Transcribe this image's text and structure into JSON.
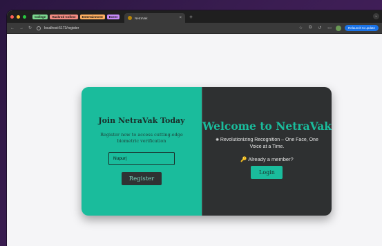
{
  "browser": {
    "tab_groups": [
      {
        "label": "College",
        "color": "#7bd88f"
      },
      {
        "label": "Hackrod Collect",
        "color": "#f28b82"
      },
      {
        "label": "Entertainment",
        "color": "#fdae61"
      },
      {
        "label": "Event",
        "color": "#c58af9"
      }
    ],
    "active_tab": {
      "title": "NetraVak",
      "close": "×"
    },
    "new_tab": "+",
    "tab_menu": "⌄",
    "url": "localhost:5173/register",
    "relaunch": "Relaunch to update"
  },
  "page": {
    "left": {
      "title": "Join NetraVak Today",
      "subtitle": "Register now to access cutting-edge biometric verification",
      "name_input_value": "Nupur|",
      "register_button": "Register"
    },
    "right": {
      "title": "Welcome to NetraVak",
      "tagline": "Revolutionizing Recognition – One Face, One Voice at a Time.",
      "member_prompt": "Already a member?",
      "login_button": "Login"
    }
  },
  "colors": {
    "accent": "#1abc9c",
    "dark": "#2e3031"
  }
}
